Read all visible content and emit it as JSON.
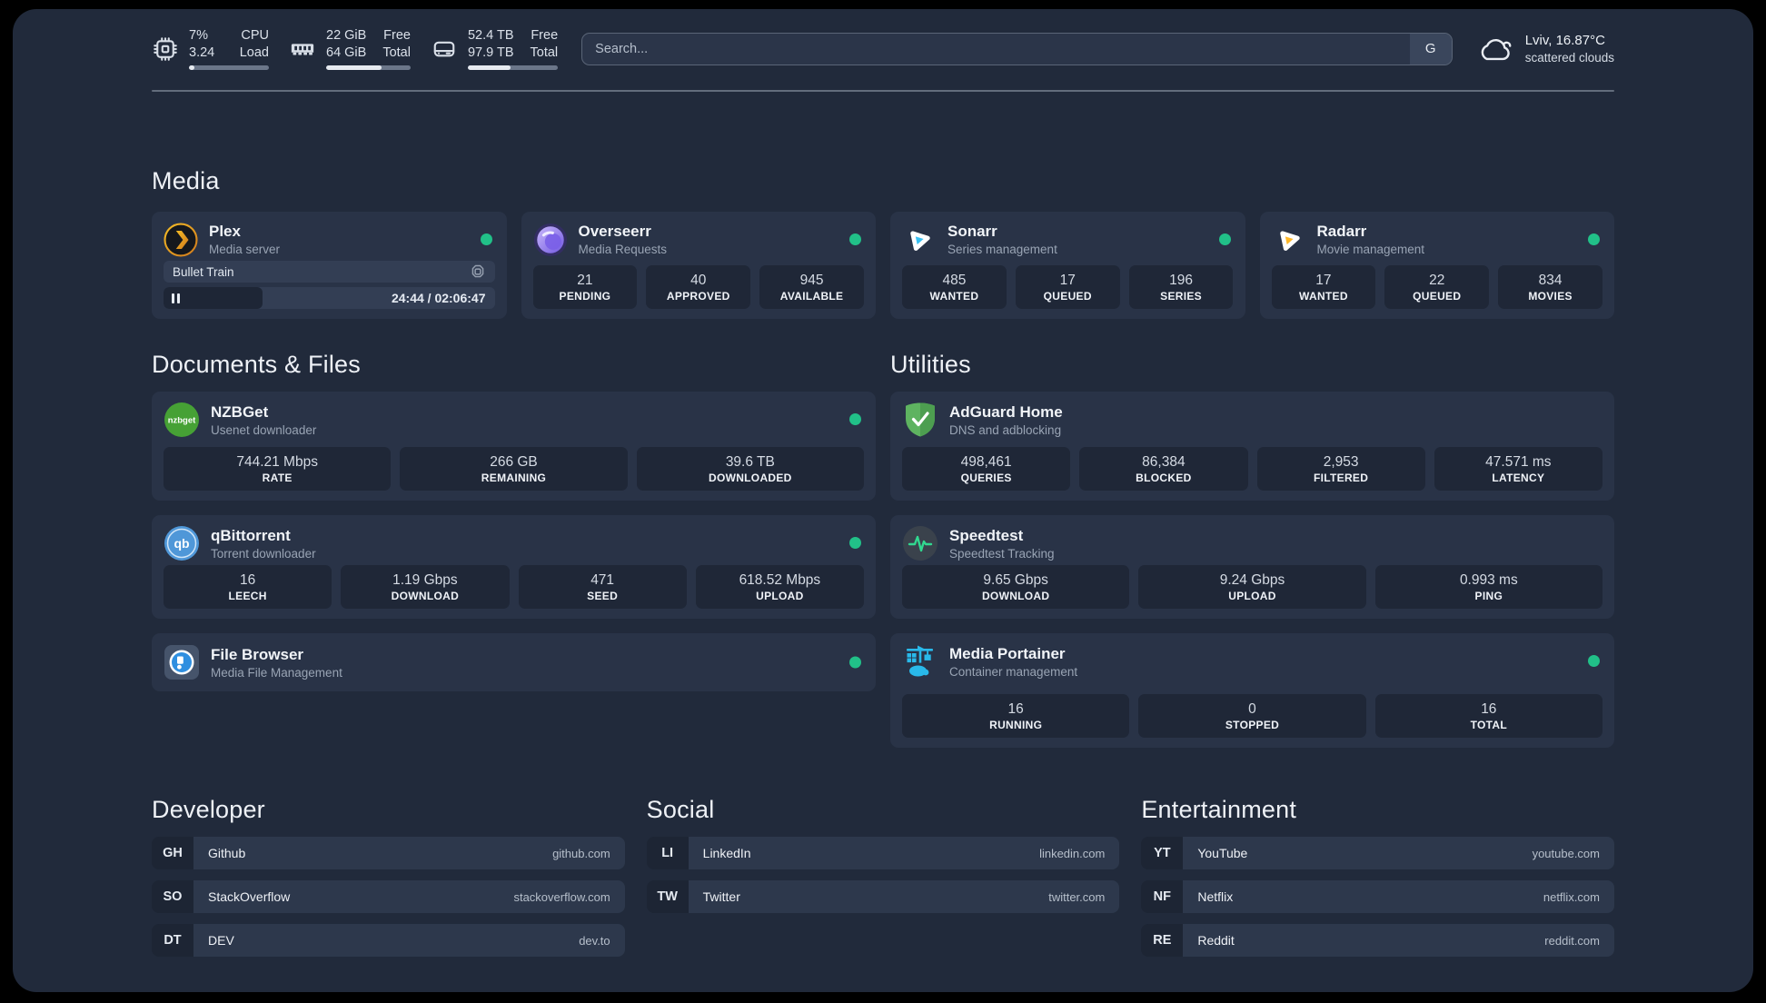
{
  "colors": {
    "status_ok": "#21c088",
    "accent_plex": "#e5a00d",
    "accent_overseerr": "#7158e0",
    "accent_sonarr": "#38c1f2",
    "accent_radarr": "#ffb829",
    "accent_nzbget": "#46a135",
    "accent_qbittorrent": "#4f97d8",
    "accent_filebrowser": "#2f8fe0",
    "accent_adguard": "#5eb360",
    "accent_speedtest": "#31d890",
    "accent_portainer": "#29b9ea"
  },
  "topbar": {
    "resources": [
      {
        "icon": "cpu-icon",
        "rows": [
          {
            "value": "7%",
            "label": "CPU"
          },
          {
            "value": "3.24",
            "label": "Load"
          }
        ],
        "progress": 7
      },
      {
        "icon": "memory-icon",
        "rows": [
          {
            "value": "22 GiB",
            "label": "Free"
          },
          {
            "value": "64 GiB",
            "label": "Total"
          }
        ],
        "progress": 66
      },
      {
        "icon": "disk-icon",
        "rows": [
          {
            "value": "52.4 TB",
            "label": "Free"
          },
          {
            "value": "97.9 TB",
            "label": "Total"
          }
        ],
        "progress": 47
      }
    ],
    "search": {
      "placeholder": "Search...",
      "provider": "G"
    },
    "weather": {
      "location": "Lviv, 16.87°C",
      "condition": "scattered clouds"
    }
  },
  "sections": {
    "media": {
      "heading": "Media"
    },
    "documents": {
      "heading": "Documents & Files"
    },
    "utilities": {
      "heading": "Utilities"
    }
  },
  "services": {
    "plex": {
      "name": "Plex",
      "desc": "Media server",
      "now_playing": "Bullet Train",
      "time": "24:44 / 02:06:47",
      "progress": 30
    },
    "overseerr": {
      "name": "Overseerr",
      "desc": "Media Requests",
      "stats": [
        {
          "value": "21",
          "label": "PENDING"
        },
        {
          "value": "40",
          "label": "APPROVED"
        },
        {
          "value": "945",
          "label": "AVAILABLE"
        }
      ]
    },
    "sonarr": {
      "name": "Sonarr",
      "desc": "Series management",
      "stats": [
        {
          "value": "485",
          "label": "WANTED"
        },
        {
          "value": "17",
          "label": "QUEUED"
        },
        {
          "value": "196",
          "label": "SERIES"
        }
      ]
    },
    "radarr": {
      "name": "Radarr",
      "desc": "Movie management",
      "stats": [
        {
          "value": "17",
          "label": "WANTED"
        },
        {
          "value": "22",
          "label": "QUEUED"
        },
        {
          "value": "834",
          "label": "MOVIES"
        }
      ]
    },
    "nzbget": {
      "name": "NZBGet",
      "desc": "Usenet downloader",
      "stats": [
        {
          "value": "744.21 Mbps",
          "label": "RATE"
        },
        {
          "value": "266 GB",
          "label": "REMAINING"
        },
        {
          "value": "39.6 TB",
          "label": "DOWNLOADED"
        }
      ]
    },
    "qbittorrent": {
      "name": "qBittorrent",
      "desc": "Torrent downloader",
      "stats": [
        {
          "value": "16",
          "label": "LEECH"
        },
        {
          "value": "1.19 Gbps",
          "label": "DOWNLOAD"
        },
        {
          "value": "471",
          "label": "SEED"
        },
        {
          "value": "618.52 Mbps",
          "label": "UPLOAD"
        }
      ]
    },
    "filebrowser": {
      "name": "File Browser",
      "desc": "Media File Management"
    },
    "adguard": {
      "name": "AdGuard Home",
      "desc": "DNS and adblocking",
      "stats": [
        {
          "value": "498,461",
          "label": "QUERIES"
        },
        {
          "value": "86,384",
          "label": "BLOCKED"
        },
        {
          "value": "2,953",
          "label": "FILTERED"
        },
        {
          "value": "47.571 ms",
          "label": "LATENCY"
        }
      ]
    },
    "speedtest": {
      "name": "Speedtest",
      "desc": "Speedtest Tracking",
      "stats": [
        {
          "value": "9.65 Gbps",
          "label": "DOWNLOAD"
        },
        {
          "value": "9.24 Gbps",
          "label": "UPLOAD"
        },
        {
          "value": "0.993 ms",
          "label": "PING"
        }
      ]
    },
    "portainer": {
      "name": "Media Portainer",
      "desc": "Container management",
      "stats": [
        {
          "value": "16",
          "label": "RUNNING"
        },
        {
          "value": "0",
          "label": "STOPPED"
        },
        {
          "value": "16",
          "label": "TOTAL"
        }
      ]
    }
  },
  "bookmarks": [
    {
      "heading": "Developer",
      "links": [
        {
          "abbr": "GH",
          "name": "Github",
          "host": "github.com"
        },
        {
          "abbr": "SO",
          "name": "StackOverflow",
          "host": "stackoverflow.com"
        },
        {
          "abbr": "DT",
          "name": "DEV",
          "host": "dev.to"
        }
      ]
    },
    {
      "heading": "Social",
      "links": [
        {
          "abbr": "LI",
          "name": "LinkedIn",
          "host": "linkedin.com"
        },
        {
          "abbr": "TW",
          "name": "Twitter",
          "host": "twitter.com"
        }
      ]
    },
    {
      "heading": "Entertainment",
      "links": [
        {
          "abbr": "YT",
          "name": "YouTube",
          "host": "youtube.com"
        },
        {
          "abbr": "NF",
          "name": "Netflix",
          "host": "netflix.com"
        },
        {
          "abbr": "RE",
          "name": "Reddit",
          "host": "reddit.com"
        }
      ]
    }
  ]
}
